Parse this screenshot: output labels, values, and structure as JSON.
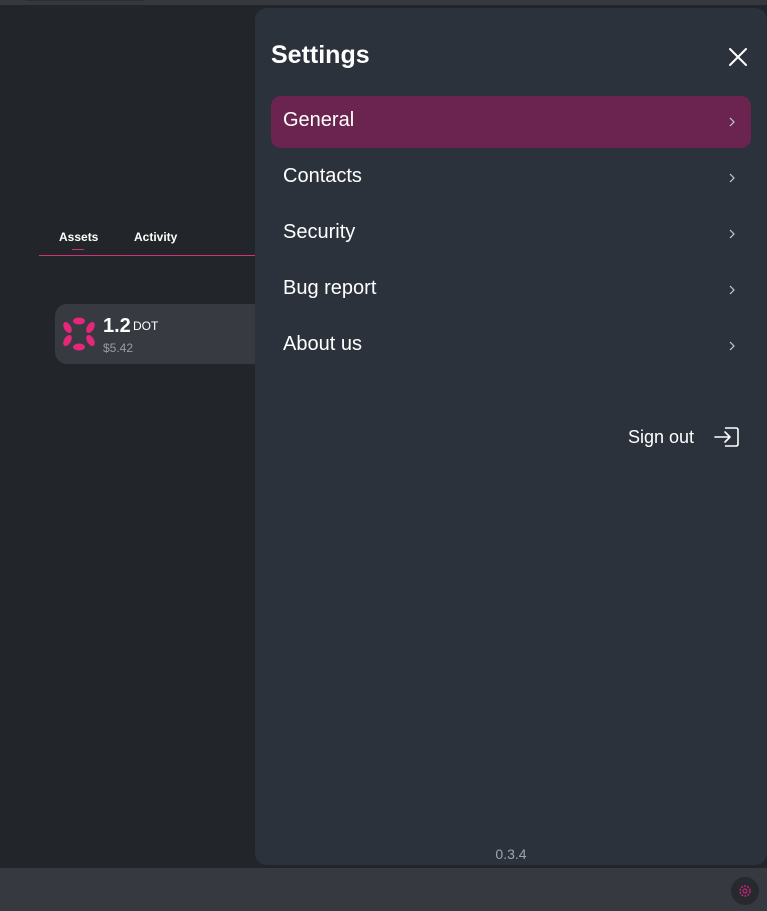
{
  "background": {
    "tabs": [
      {
        "label": "Assets",
        "active": true
      },
      {
        "label": "Activity",
        "active": false
      }
    ],
    "asset": {
      "amount": "1.2",
      "symbol": "DOT",
      "fiat_value": "$5.42",
      "icon": "polkadot-logo-icon"
    }
  },
  "settings": {
    "title": "Settings",
    "close_icon": "close-icon",
    "menu": [
      {
        "label": "General",
        "active": true
      },
      {
        "label": "Contacts",
        "active": false
      },
      {
        "label": "Security",
        "active": false
      },
      {
        "label": "Bug report",
        "active": false
      },
      {
        "label": "About us",
        "active": false
      }
    ],
    "sign_out_label": "Sign out",
    "sign_out_icon": "sign-out-icon",
    "version": "0.3.4"
  },
  "bottombar": {
    "settings_icon": "gear-icon"
  },
  "colors": {
    "accent": "#d33079",
    "active_item": "#6b2450",
    "panel": "#2c323c",
    "background": "#222529"
  }
}
